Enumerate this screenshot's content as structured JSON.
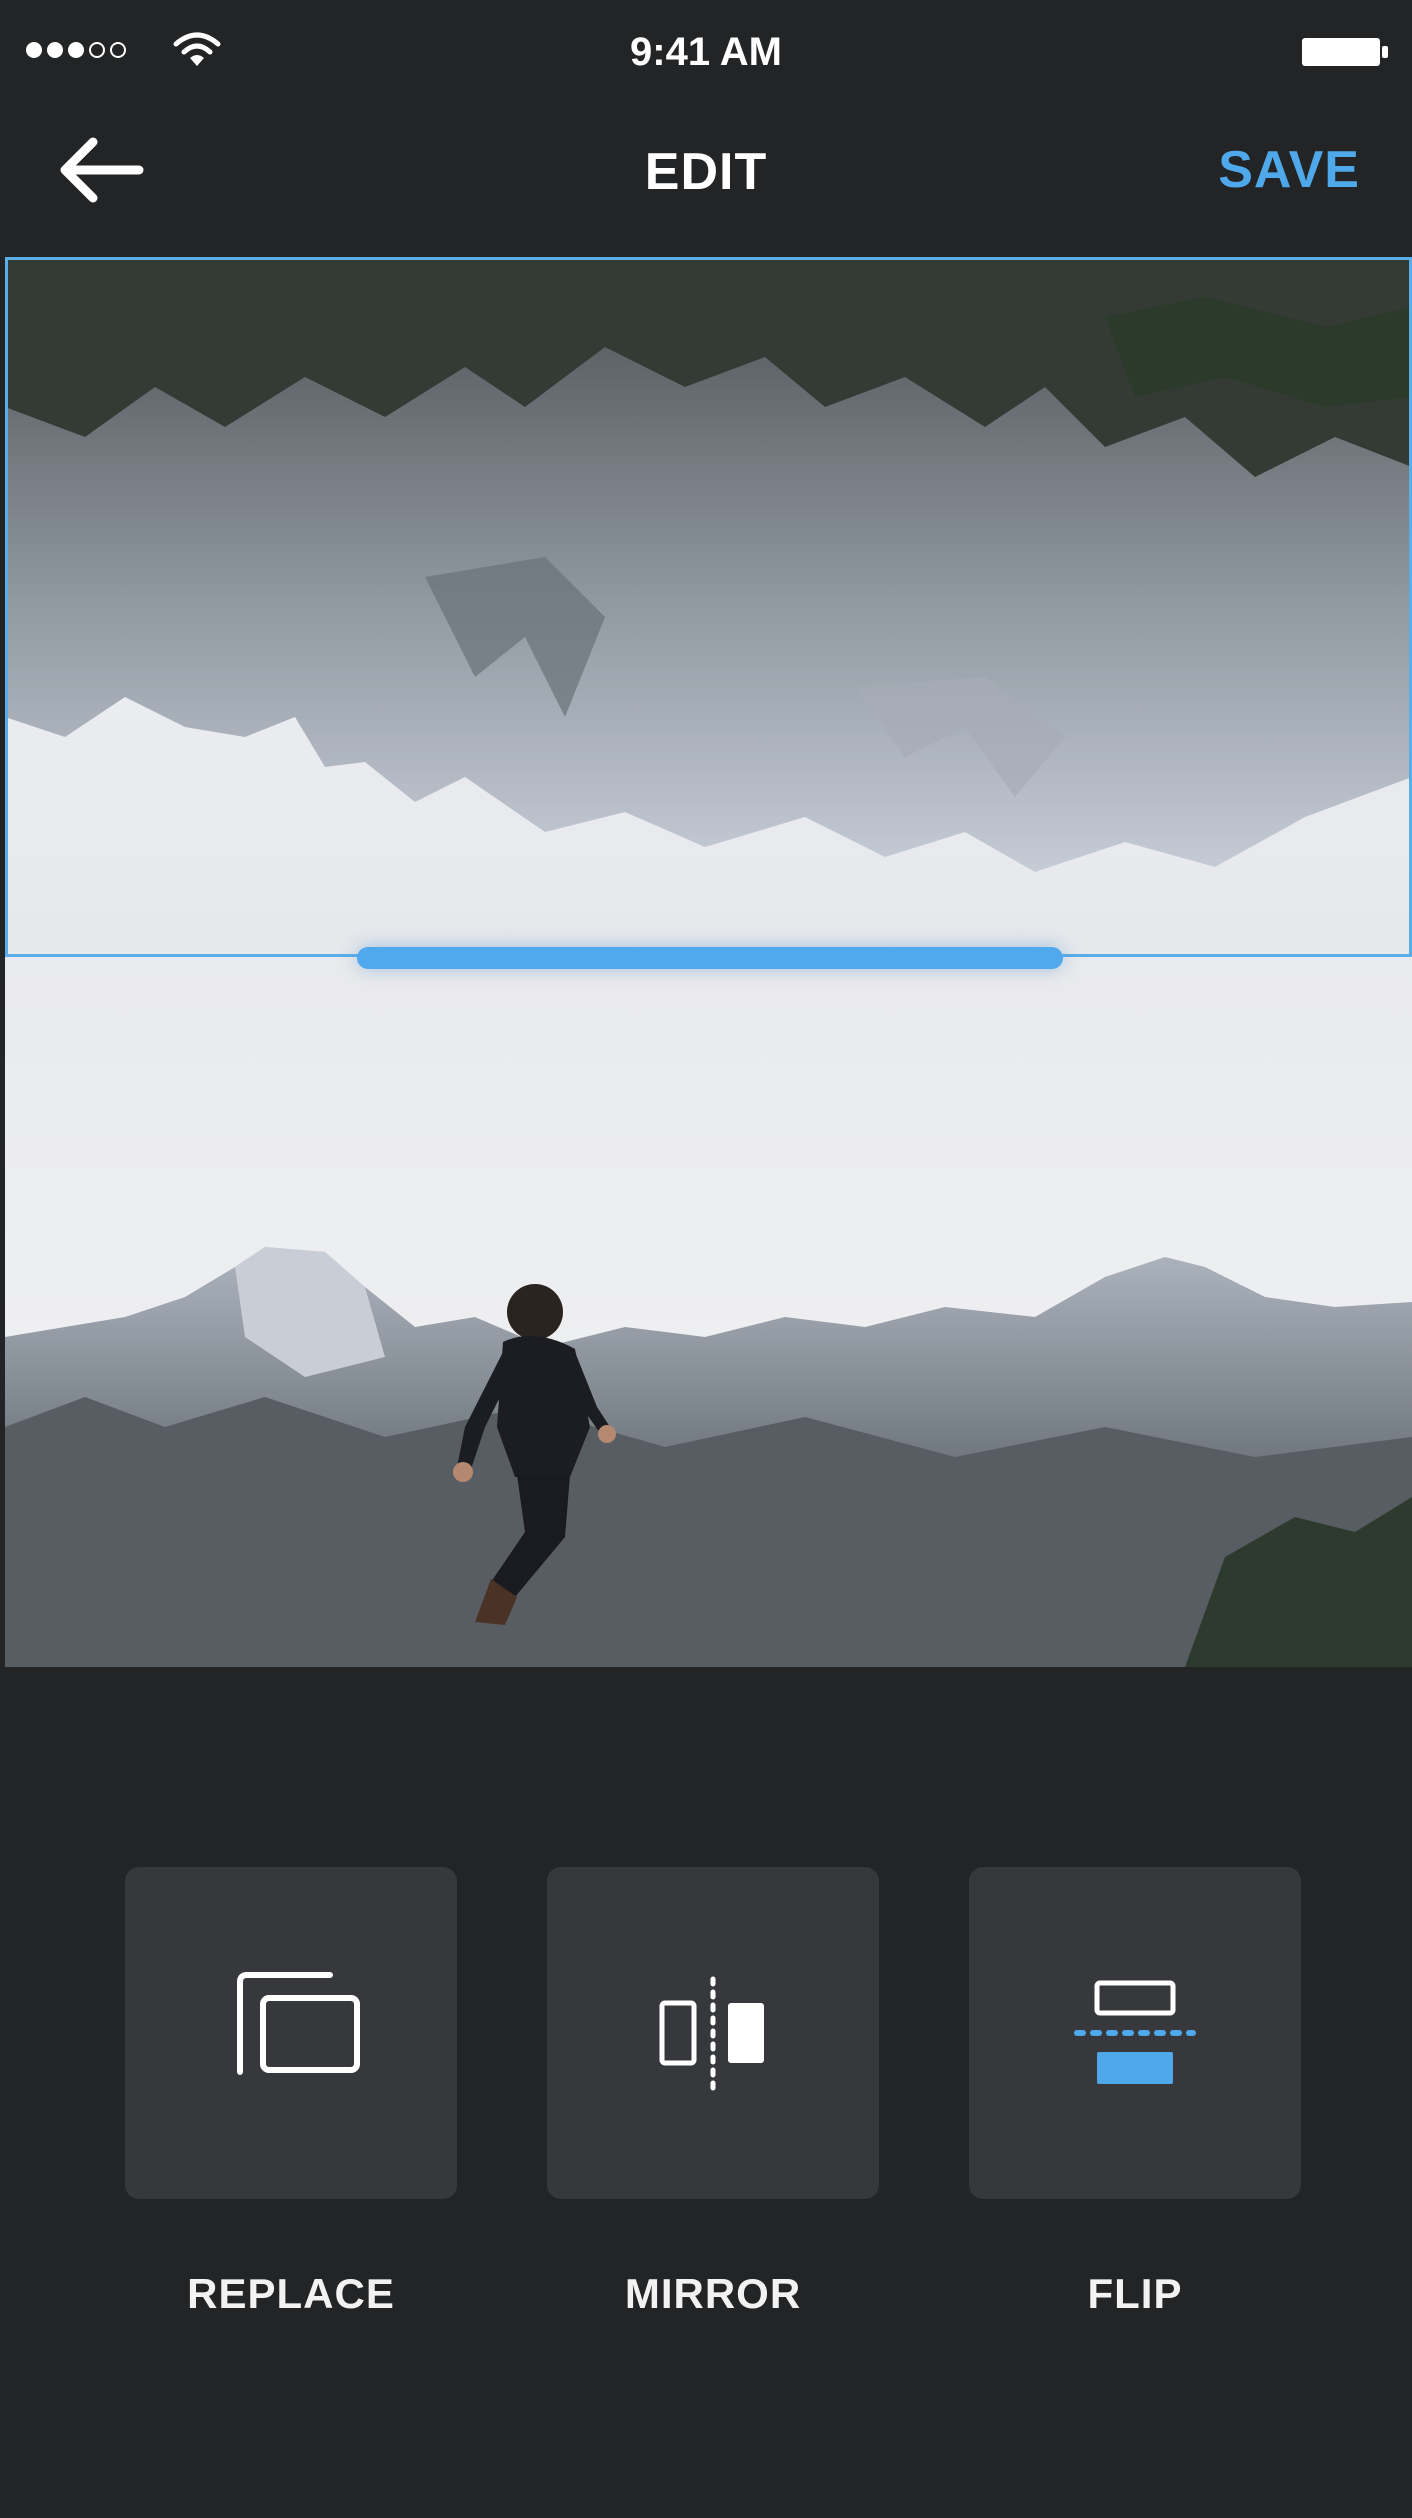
{
  "status_bar": {
    "time": "9:41 AM",
    "signal_bars_filled": 3,
    "signal_bars_total": 5,
    "icons": [
      "signal-dots-icon",
      "wifi-icon",
      "battery-icon"
    ]
  },
  "nav": {
    "title": "EDIT",
    "save_label": "SAVE",
    "back_icon": "arrow-left-icon"
  },
  "canvas": {
    "top_image": "mountain-photo-flipped",
    "bottom_image": "person-jumping-mountain-photo"
  },
  "tools": [
    {
      "label": "REPLACE",
      "icon": "replace-icon",
      "active": false
    },
    {
      "label": "MIRROR",
      "icon": "mirror-icon",
      "active": false
    },
    {
      "label": "FLIP",
      "icon": "flip-icon",
      "active": true
    }
  ],
  "colors": {
    "accent": "#4ea8ea",
    "background": "#232425",
    "tool_tile": "#37383b"
  }
}
